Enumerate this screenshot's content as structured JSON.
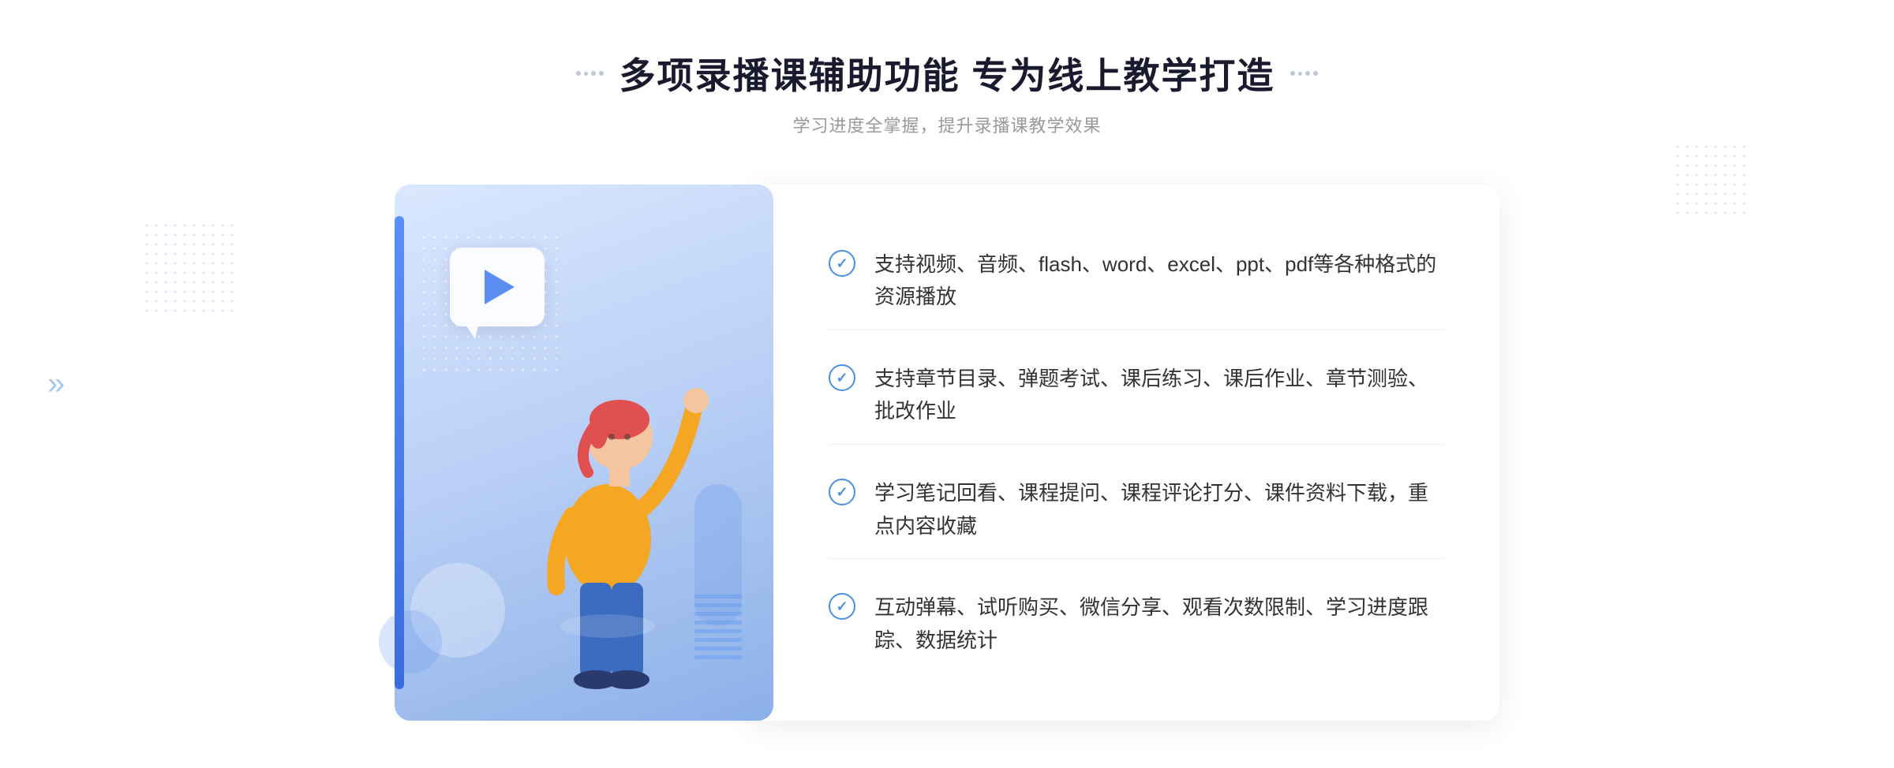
{
  "header": {
    "title": "多项录播课辅助功能 专为线上教学打造",
    "subtitle": "学习进度全掌握，提升录播课教学效果",
    "dots_left": [
      "●",
      "●",
      "●"
    ],
    "dots_right": [
      "●",
      "●",
      "●"
    ]
  },
  "features": [
    {
      "id": 1,
      "text": "支持视频、音频、flash、word、excel、ppt、pdf等各种格式的资源播放"
    },
    {
      "id": 2,
      "text": "支持章节目录、弹题考试、课后练习、课后作业、章节测验、批改作业"
    },
    {
      "id": 3,
      "text": "学习笔记回看、课程提问、课程评论打分、课件资料下载，重点内容收藏"
    },
    {
      "id": 4,
      "text": "互动弹幕、试听购买、微信分享、观看次数限制、学习进度跟踪、数据统计"
    }
  ],
  "illustration": {
    "play_icon": "▶",
    "chevron_left": "»"
  },
  "colors": {
    "primary": "#4a90e2",
    "title": "#1a1a2e",
    "subtitle": "#999999",
    "feature_text": "#333333",
    "card_bg": "#ffffff",
    "illus_bg_start": "#dae8ff",
    "illus_bg_end": "#8bb0e8"
  }
}
